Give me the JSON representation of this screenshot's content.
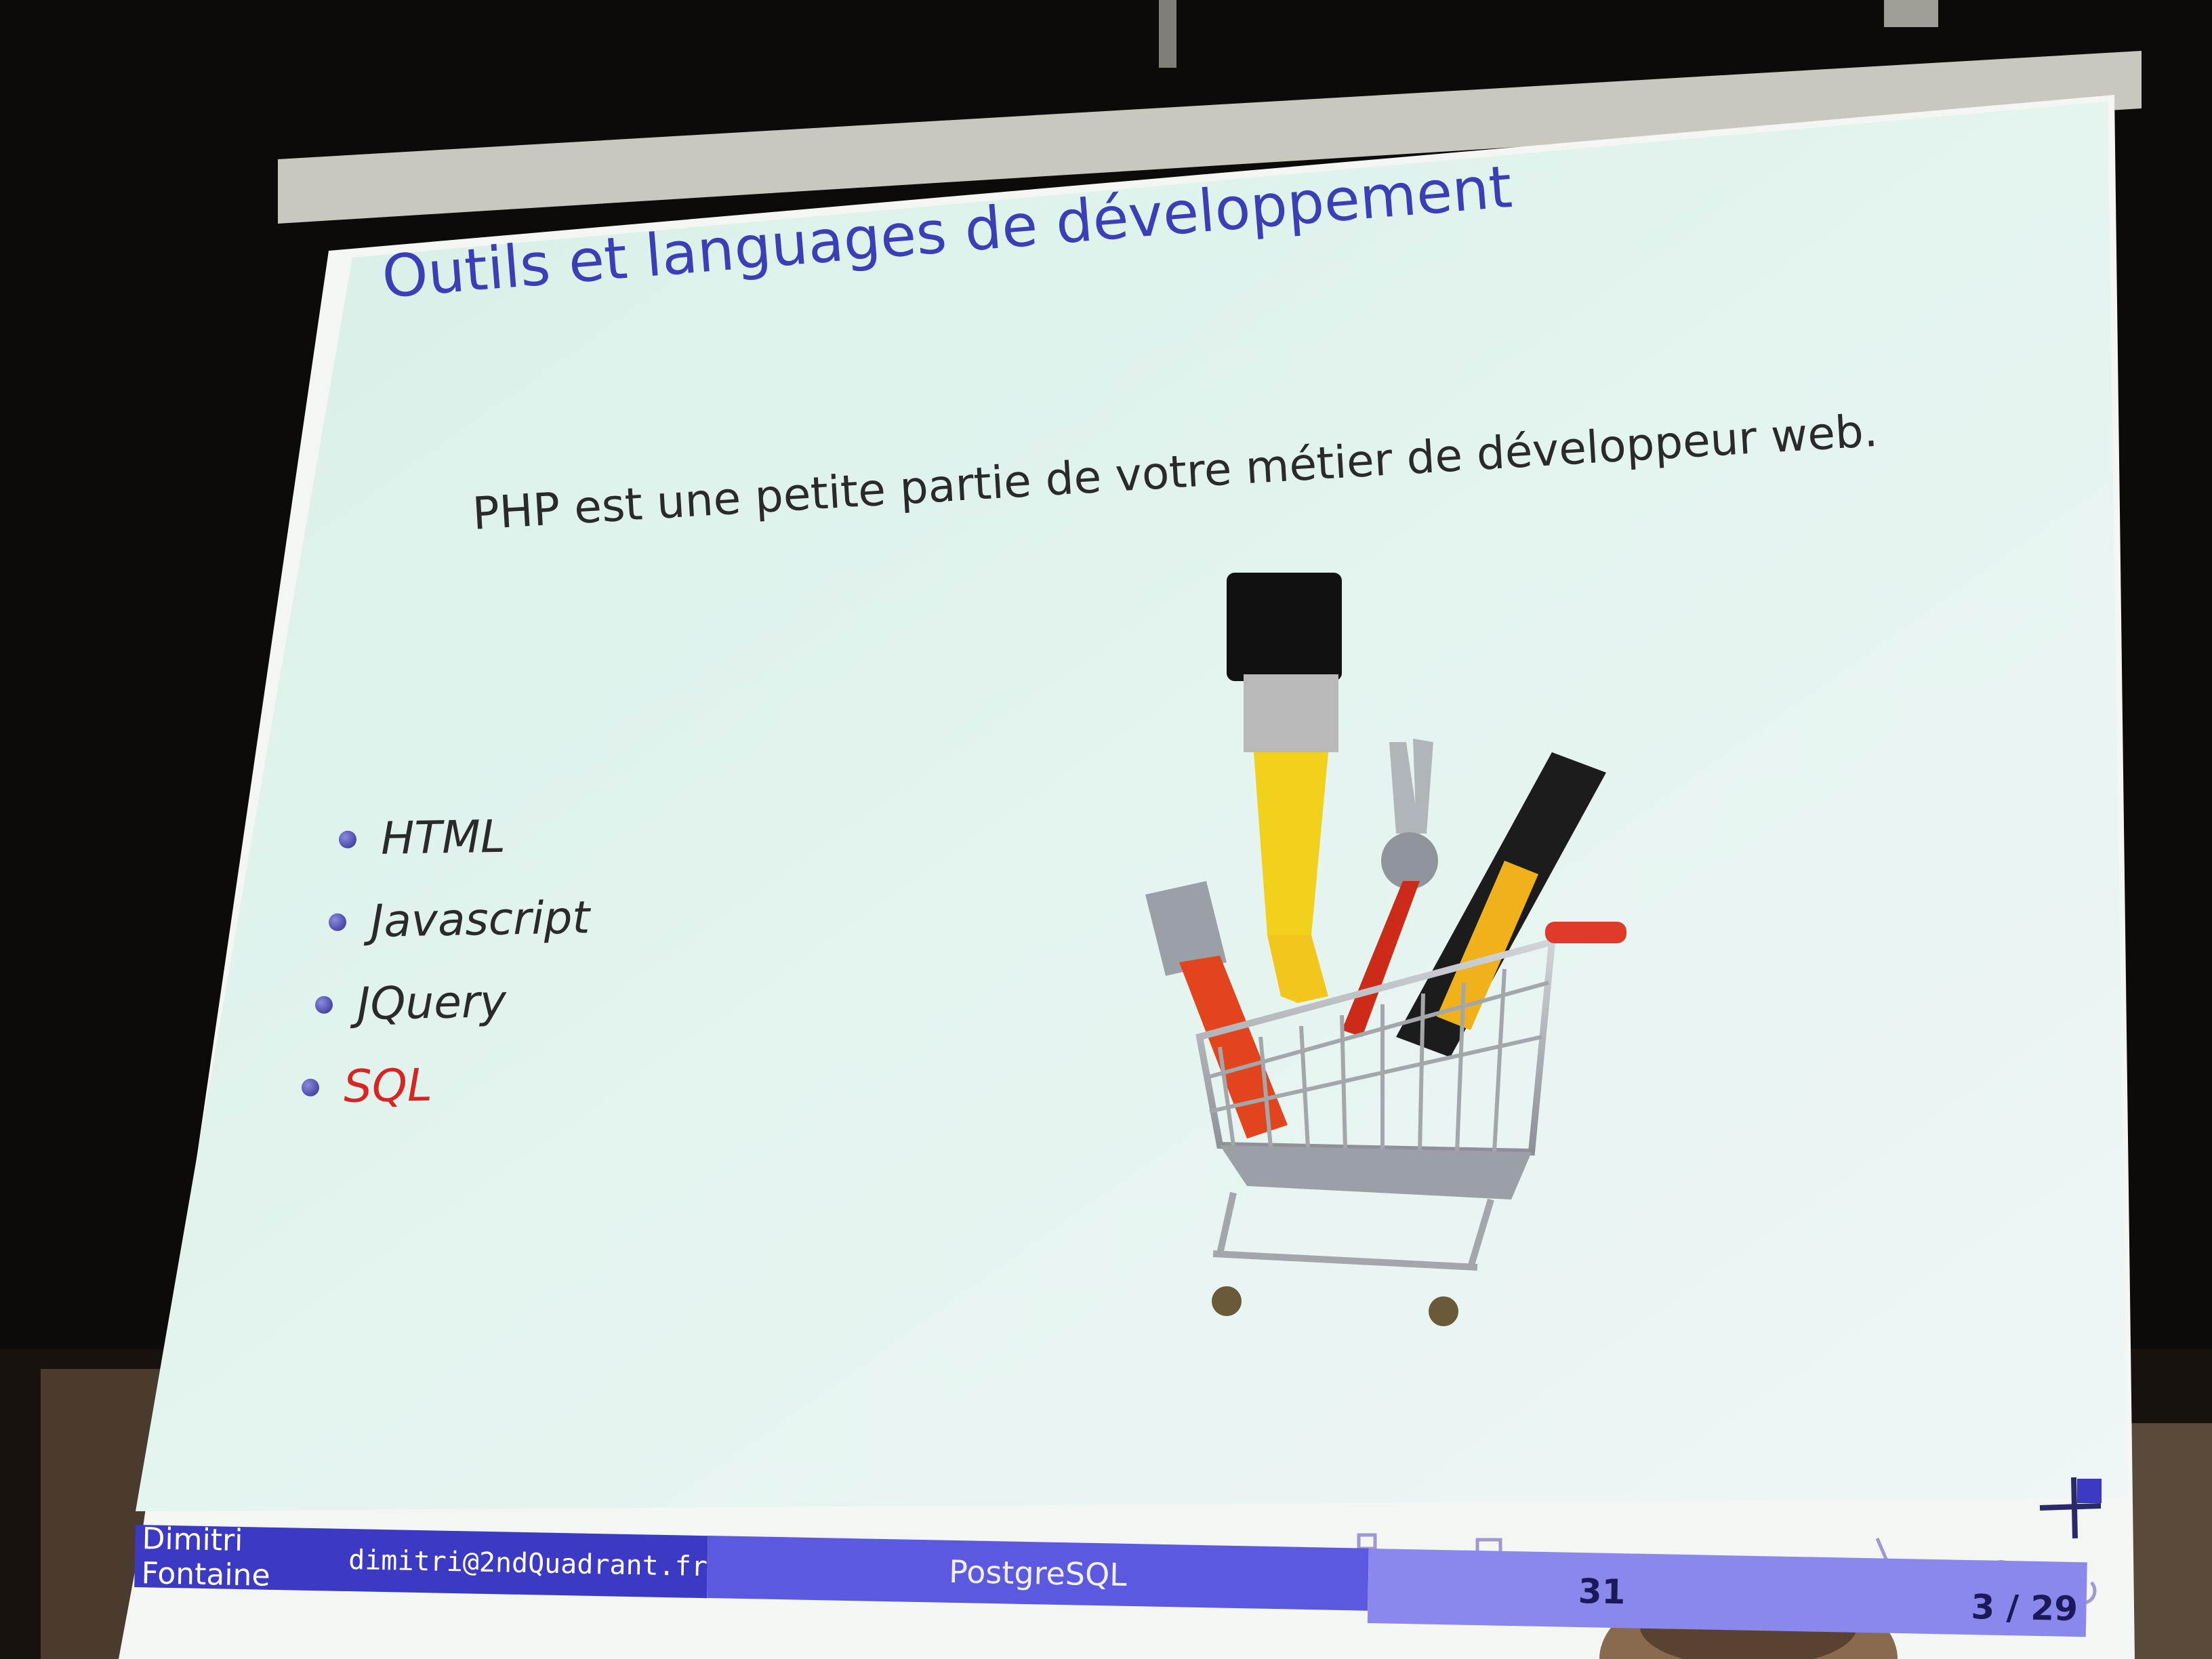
{
  "slide": {
    "title": "Outils et languages de développement",
    "subtitle": "PHP est une petite partie de votre métier de développeur web.",
    "bullets": [
      {
        "label": "HTML"
      },
      {
        "label": "Javascript"
      },
      {
        "label": "JQuery"
      },
      {
        "label": "SQL"
      }
    ],
    "image": "tools-in-shopping-cart"
  },
  "footer": {
    "author": "Dimitri Fontaine",
    "email": "dimitri@2ndQuadrant.fr",
    "topic": "PostgreSQL",
    "date": "31",
    "page": "3 / 29"
  },
  "colors": {
    "title": "#3a3fb8",
    "accent": "#d92424",
    "footer_dark": "#3c3ac4",
    "footer_mid": "#5c59e0",
    "footer_light": "#8a88ec"
  }
}
